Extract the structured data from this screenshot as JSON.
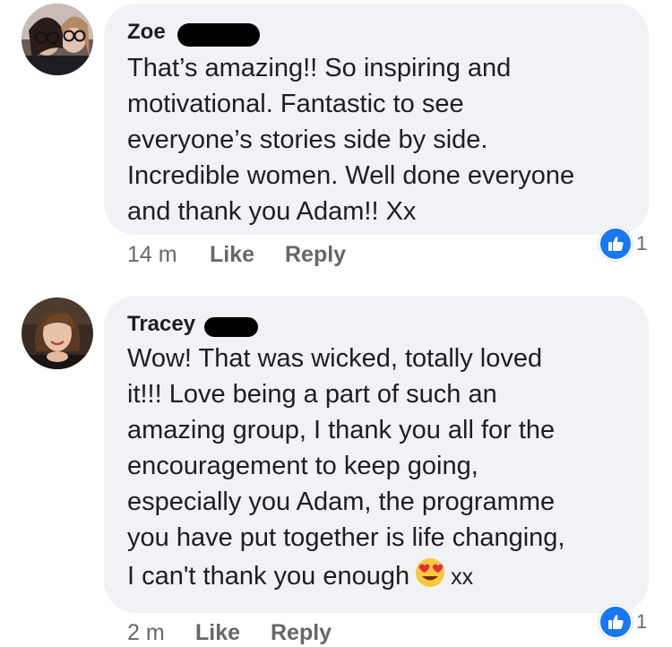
{
  "comments": [
    {
      "author": "Zoe",
      "text": "That’s amazing!! So inspiring and\nmotivational. Fantastic to see\neveryone’s stories side by side.\nIncredible women. Well done everyone\nand thank you Adam!! Xx",
      "time": "14 m",
      "like_label": "Like",
      "reply_label": "Reply",
      "reaction_count": "1",
      "avatar_icon": "profile-photo-two-women-glasses"
    },
    {
      "author": "Tracey",
      "text": "Wow! That was wicked, totally loved\nit!!! Love being a part of such an\namazing group, I thank you all for the\nencouragement to keep going,\nespecially you Adam, the programme\nyou have put together is life changing,",
      "last_line_before": "I can't thank you enough",
      "emoji_icon": "heart-eyes-emoji",
      "last_line_after": "xx",
      "time": "2 m",
      "like_label": "Like",
      "reply_label": "Reply",
      "reaction_count": "1",
      "avatar_icon": "profile-photo-woman-brown-hair"
    }
  ],
  "colors": {
    "bubble": "#f0f2f5",
    "like_blue": "#1877f2",
    "meta_gray": "#65676b"
  }
}
